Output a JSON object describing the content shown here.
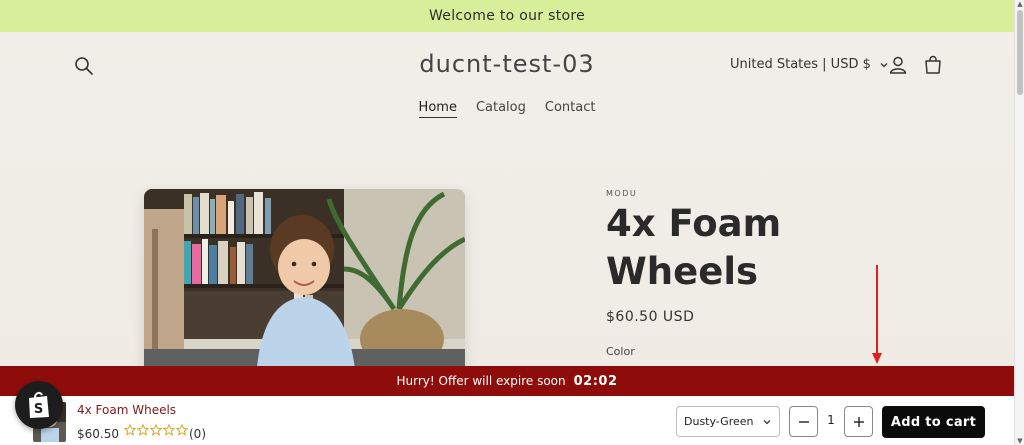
{
  "announcement": {
    "text": "Welcome to our store"
  },
  "header": {
    "store_name": "ducnt-test-03",
    "locale": "United States | USD $",
    "nav": [
      {
        "label": "Home",
        "active": true
      },
      {
        "label": "Catalog",
        "active": false
      },
      {
        "label": "Contact",
        "active": false
      }
    ]
  },
  "product": {
    "vendor": "MODU",
    "title": "4x Foam Wheels",
    "price": "$60.50 USD",
    "color_label": "Color"
  },
  "timer": {
    "message": "Hurry! Offer will expire soon",
    "countdown": "02:02"
  },
  "sticky_bar": {
    "title": "4x Foam Wheels",
    "price": "$60.50",
    "rating_count": "(0)",
    "rating_stars": 0,
    "variant": "Dusty-Green",
    "quantity": "1",
    "add_to_cart_label": "Add to cart"
  },
  "colors": {
    "announcement_bg": "#d7ee9a",
    "timer_bg": "#8e0d0b",
    "add_to_cart_bg": "#0b0b0b",
    "star_color": "#d4a017",
    "annotation_arrow": "#e02020"
  }
}
